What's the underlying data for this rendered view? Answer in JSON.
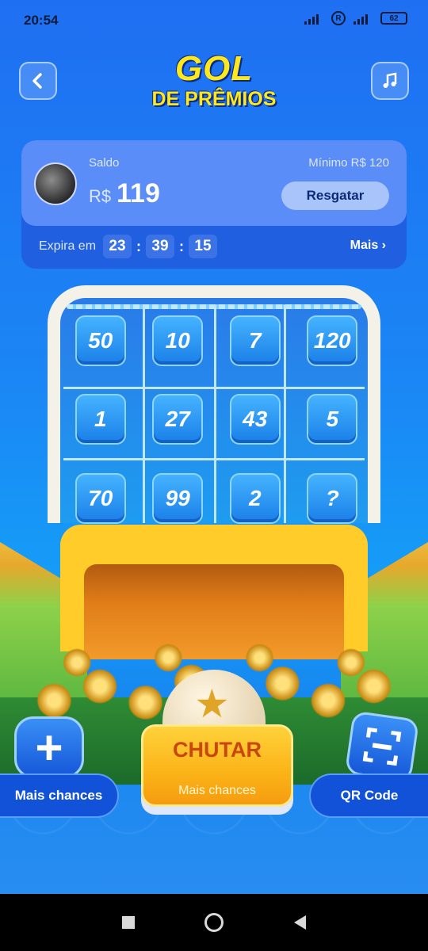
{
  "status_bar": {
    "time": "20:54",
    "network": "4G",
    "battery": "62"
  },
  "header": {
    "title_line1": "GOL",
    "title_line2": "DE PRÊMIOS",
    "back_icon": "chevron-left-icon",
    "music_icon": "music-note-icon"
  },
  "balance": {
    "label": "Saldo",
    "currency": "R$",
    "value": "119",
    "minimum_label": "Mínimo  R$ 120",
    "redeem_label": "Resgatar"
  },
  "expiry": {
    "label": "Expira em",
    "hours": "23",
    "minutes": "39",
    "seconds": "15",
    "more_label": "Mais ›"
  },
  "prize_grid": [
    [
      "50",
      "10",
      "7",
      "120"
    ],
    [
      "1",
      "27",
      "43",
      "5"
    ],
    [
      "70",
      "99",
      "2",
      "?"
    ]
  ],
  "controls": {
    "more_chances_label": "Mais chances",
    "kick_label": "CHUTAR",
    "kick_sublabel": "Mais chances",
    "qr_label": "QR Code"
  },
  "colors": {
    "background": "#1b86f5",
    "title": "#ffe81a",
    "kick_button": "#fbb317",
    "kick_text": "#c9460f"
  }
}
